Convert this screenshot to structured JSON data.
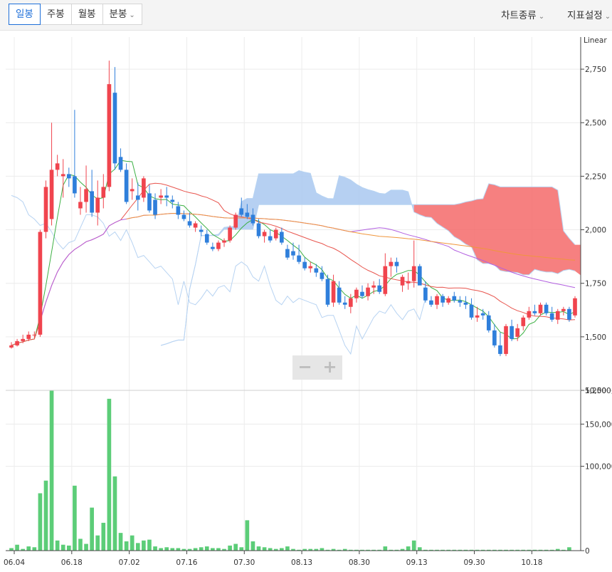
{
  "toolbar": {
    "tabs": [
      {
        "label": "일봉",
        "active": true
      },
      {
        "label": "주봉",
        "active": false
      },
      {
        "label": "월봉",
        "active": false
      },
      {
        "label": "분봉",
        "active": false
      }
    ],
    "chart_type_menu": "차트종류",
    "indicator_menu": "지표설정"
  },
  "colors": {
    "up": "#f0444e",
    "down": "#2f7fdb",
    "ma5": "#3cb043",
    "ma20": "#e8554e",
    "ma60": "#b25fe0",
    "ma120": "#f0963c",
    "cloud_bear": "#f56a6a",
    "cloud_bull": "#a9c8f0",
    "ichimoku_line": "#b7d3f2",
    "volume": "#5ccd78",
    "active_tab": "#1e6fd9"
  },
  "chart_data": {
    "type": "candlestick",
    "scale_label": "Linear",
    "price_axis": {
      "ylim": [
        1250,
        2900
      ],
      "ticks": [
        "2,750",
        "2,500",
        "2,250",
        "2,000",
        "1,750",
        "1,500",
        "1,250"
      ]
    },
    "volume_axis": {
      "ylim": [
        0,
        190000
      ],
      "ticks": [
        "150,000,",
        "100,000,",
        "50,000,0",
        "0"
      ]
    },
    "x_ticks": [
      {
        "i": 0,
        "label": "06.04"
      },
      {
        "i": 10,
        "label": "06.18"
      },
      {
        "i": 20,
        "label": "07.02"
      },
      {
        "i": 30,
        "label": "07.16"
      },
      {
        "i": 40,
        "label": "07.30"
      },
      {
        "i": 50,
        "label": "08.13"
      },
      {
        "i": 60,
        "label": "08.30"
      },
      {
        "i": 70,
        "label": "09.13"
      },
      {
        "i": 80,
        "label": "09.30"
      },
      {
        "i": 90,
        "label": "10.18"
      }
    ],
    "candles": [
      [
        1450,
        1475,
        1445,
        1460
      ],
      [
        1460,
        1490,
        1455,
        1480
      ],
      [
        1480,
        1510,
        1470,
        1490
      ],
      [
        1490,
        1525,
        1480,
        1510
      ],
      [
        1510,
        1525,
        1495,
        1510
      ],
      [
        1510,
        2000,
        1500,
        1990
      ],
      [
        1990,
        2230,
        1960,
        2200
      ],
      [
        2050,
        2500,
        2020,
        2280
      ],
      [
        2280,
        2350,
        2250,
        2310
      ],
      [
        2250,
        2330,
        2150,
        2260
      ],
      [
        2260,
        2290,
        2200,
        2240
      ],
      [
        2250,
        2560,
        2150,
        2170
      ],
      [
        2100,
        2200,
        2070,
        2130
      ],
      [
        2130,
        2300,
        2080,
        2190
      ],
      [
        2180,
        2280,
        2060,
        2080
      ],
      [
        2080,
        2230,
        2020,
        2150
      ],
      [
        2150,
        2260,
        2100,
        2200
      ],
      [
        2200,
        2790,
        2180,
        2680
      ],
      [
        2640,
        2760,
        2280,
        2310
      ],
      [
        2340,
        2380,
        2270,
        2280
      ],
      [
        2280,
        2310,
        2120,
        2130
      ],
      [
        2180,
        2240,
        2140,
        2190
      ],
      [
        2160,
        2220,
        2090,
        2140
      ],
      [
        2150,
        2250,
        2130,
        2240
      ],
      [
        2170,
        2210,
        2080,
        2090
      ],
      [
        2140,
        2170,
        2050,
        2070
      ],
      [
        2150,
        2190,
        2120,
        2160
      ],
      [
        2160,
        2200,
        2110,
        2150
      ],
      [
        2140,
        2160,
        2100,
        2130
      ],
      [
        2110,
        2130,
        2050,
        2070
      ],
      [
        2070,
        2090,
        2040,
        2050
      ],
      [
        2040,
        2080,
        2010,
        2020
      ],
      [
        2010,
        2040,
        1990,
        2030
      ],
      [
        2000,
        2020,
        1970,
        1990
      ],
      [
        1980,
        2000,
        1930,
        1940
      ],
      [
        1920,
        1940,
        1900,
        1910
      ],
      [
        1910,
        1950,
        1900,
        1940
      ],
      [
        1940,
        1960,
        1920,
        1950
      ],
      [
        1950,
        2020,
        1940,
        2010
      ],
      [
        2010,
        2080,
        2000,
        2070
      ],
      [
        2100,
        2150,
        2060,
        2070
      ],
      [
        2080,
        2120,
        2050,
        2060
      ],
      [
        2070,
        2100,
        2020,
        2030
      ],
      [
        2030,
        2050,
        1960,
        1970
      ],
      [
        1970,
        2000,
        1940,
        1990
      ],
      [
        1970,
        2000,
        1940,
        1950
      ],
      [
        1960,
        2010,
        1950,
        2000
      ],
      [
        1990,
        2010,
        1930,
        1940
      ],
      [
        1910,
        1930,
        1860,
        1870
      ],
      [
        1900,
        1940,
        1860,
        1880
      ],
      [
        1880,
        1930,
        1840,
        1850
      ],
      [
        1850,
        1870,
        1810,
        1820
      ],
      [
        1820,
        1850,
        1800,
        1830
      ],
      [
        1820,
        1840,
        1780,
        1800
      ],
      [
        1800,
        1830,
        1760,
        1770
      ],
      [
        1770,
        1790,
        1640,
        1650
      ],
      [
        1660,
        1790,
        1640,
        1760
      ],
      [
        1730,
        1760,
        1650,
        1660
      ],
      [
        1660,
        1690,
        1630,
        1650
      ],
      [
        1640,
        1700,
        1610,
        1680
      ],
      [
        1680,
        1730,
        1660,
        1720
      ],
      [
        1710,
        1740,
        1680,
        1690
      ],
      [
        1690,
        1750,
        1670,
        1730
      ],
      [
        1730,
        1760,
        1700,
        1740
      ],
      [
        1740,
        1770,
        1700,
        1710
      ],
      [
        1700,
        1890,
        1690,
        1830
      ],
      [
        1830,
        1870,
        1780,
        1850
      ],
      [
        1850,
        1870,
        1800,
        1830
      ],
      [
        1740,
        1790,
        1710,
        1780
      ],
      [
        1750,
        1800,
        1720,
        1760
      ],
      [
        1760,
        1950,
        1730,
        1830
      ],
      [
        1830,
        1840,
        1750,
        1740
      ],
      [
        1730,
        1760,
        1660,
        1670
      ],
      [
        1670,
        1690,
        1640,
        1650
      ],
      [
        1650,
        1700,
        1630,
        1690
      ],
      [
        1690,
        1700,
        1640,
        1660
      ],
      [
        1660,
        1690,
        1650,
        1680
      ],
      [
        1690,
        1710,
        1660,
        1670
      ],
      [
        1670,
        1690,
        1640,
        1660
      ],
      [
        1660,
        1690,
        1630,
        1650
      ],
      [
        1650,
        1680,
        1580,
        1590
      ],
      [
        1590,
        1640,
        1570,
        1600
      ],
      [
        1610,
        1630,
        1580,
        1600
      ],
      [
        1600,
        1620,
        1520,
        1530
      ],
      [
        1530,
        1560,
        1450,
        1460
      ],
      [
        1460,
        1520,
        1410,
        1420
      ],
      [
        1420,
        1560,
        1410,
        1550
      ],
      [
        1550,
        1580,
        1480,
        1490
      ],
      [
        1500,
        1560,
        1480,
        1540
      ],
      [
        1550,
        1600,
        1530,
        1590
      ],
      [
        1590,
        1640,
        1580,
        1620
      ],
      [
        1620,
        1650,
        1600,
        1610
      ],
      [
        1610,
        1660,
        1600,
        1650
      ],
      [
        1650,
        1660,
        1600,
        1610
      ],
      [
        1610,
        1640,
        1570,
        1580
      ],
      [
        1580,
        1630,
        1560,
        1620
      ],
      [
        1620,
        1640,
        1600,
        1630
      ],
      [
        1630,
        1640,
        1570,
        1580
      ],
      [
        1600,
        1690,
        1590,
        1680
      ]
    ],
    "volume": [
      3000,
      7000,
      2000,
      5000,
      4000,
      68000,
      83000,
      190000,
      12000,
      7000,
      6000,
      77000,
      14000,
      8000,
      51000,
      18000,
      33000,
      180000,
      88000,
      21000,
      11000,
      18000,
      9000,
      12000,
      13000,
      5000,
      3000,
      4000,
      3000,
      3000,
      2000,
      2000,
      3000,
      4000,
      5000,
      3000,
      3000,
      2000,
      6000,
      8000,
      4000,
      36000,
      11000,
      5000,
      4000,
      3000,
      2000,
      3000,
      5000,
      2000,
      1000,
      2000,
      2000,
      2000,
      3000,
      1000,
      2000,
      1000,
      2000,
      1000,
      1000,
      1000,
      1000,
      1000,
      1000,
      5000,
      1000,
      1000,
      2000,
      5000,
      12000,
      4000,
      1000,
      1000,
      1000,
      1000,
      1000,
      1000,
      1000,
      1000,
      1000,
      1000,
      1000,
      1000,
      1000,
      1000,
      1000,
      1000,
      1000,
      1000,
      1000,
      1000,
      1000,
      1000,
      1000,
      2000,
      1000,
      4000
    ]
  }
}
